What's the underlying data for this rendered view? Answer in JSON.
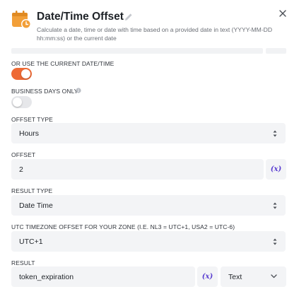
{
  "header": {
    "title": "Date/Time Offset",
    "subtitle": "Calculate a date, time or date with time based on a provided date in text (YYYY-MM-DD hh:mm:ss) or the current date",
    "accent": "#f29f38"
  },
  "form": {
    "use_current": {
      "label": "OR USE THE CURRENT DATE/TIME",
      "on": true
    },
    "business_days": {
      "label": "BUSINESS DAYS ONLY",
      "on": false
    },
    "offset_type": {
      "label": "OFFSET TYPE",
      "value": "Hours"
    },
    "offset": {
      "label": "OFFSET",
      "value": "2",
      "var_label": "(x)"
    },
    "result_type": {
      "label": "RESULT TYPE",
      "value": "Date Time"
    },
    "timezone": {
      "label": "UTC TIMEZONE OFFSET FOR YOUR ZONE (I.E. NL3 = UTC+1, USA2 = UTC-6)",
      "value": "UTC+1"
    },
    "result": {
      "label": "RESULT",
      "value": "token_expiration",
      "var_label": "(x)",
      "type": "Text"
    }
  },
  "colors": {
    "toggle_on": "#ee6a35",
    "variable": "#5b3fd1",
    "field_bg": "#f3f4f6"
  },
  "icons": [
    "calendar-clock-icon",
    "pencil-icon",
    "close-icon",
    "info-icon",
    "updown-icon",
    "variable-icon",
    "chevron-down-icon"
  ]
}
